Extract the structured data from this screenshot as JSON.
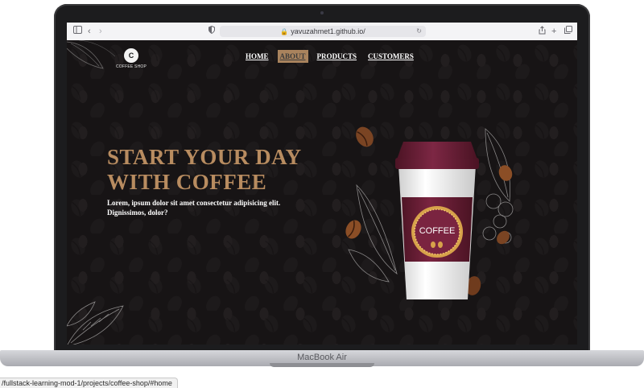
{
  "browser": {
    "url": "yavuzahmet1.github.io/"
  },
  "site": {
    "logo_mark": "C",
    "logo_text": "COFFEE SHOP",
    "nav": [
      {
        "label": "HOME",
        "active": false
      },
      {
        "label": "ABOUT",
        "active": true
      },
      {
        "label": "PRODUCTS",
        "active": false
      },
      {
        "label": "CUSTOMERS",
        "active": false
      }
    ],
    "hero_title_line1": "START YOUR DAY",
    "hero_title_line2": "WITH COFFEE",
    "hero_subtitle": "Lorem, ipsum dolor sit amet consectetur adipisicing elit. Dignissimos, dolor?",
    "cup_label": "COFFEE"
  },
  "device": {
    "label": "MacBook Air"
  },
  "status": {
    "hover_url": "/fullstack-learning-mod-1/projects/coffee-shop/#home"
  },
  "colors": {
    "accent": "#b88c60",
    "nav_active_bg": "#a9835d",
    "cup_maroon": "#6b1f35",
    "background": "#171415"
  },
  "icons": {
    "sidebar": "sidebar-icon",
    "back": "chevron-left-icon",
    "forward": "chevron-right-icon",
    "privacy": "shield-icon",
    "lock": "lock-icon",
    "reload": "reload-icon",
    "share": "share-icon",
    "new_tab": "plus-icon",
    "tabs": "tabs-icon"
  }
}
